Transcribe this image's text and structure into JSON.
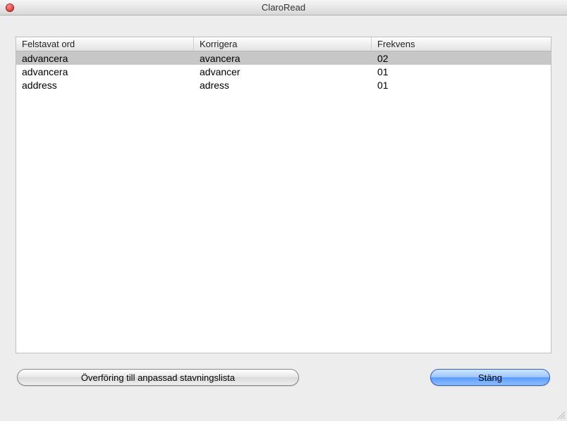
{
  "window": {
    "title": "ClaroRead"
  },
  "table": {
    "headers": {
      "misspelled": "Felstavat ord",
      "correction": "Korrigera",
      "frequency": "Frekvens"
    },
    "rows": [
      {
        "misspelled": "advancera",
        "correction": "avancera",
        "frequency": "02",
        "selected": true
      },
      {
        "misspelled": "advancera",
        "correction": "advancer",
        "frequency": "01",
        "selected": false
      },
      {
        "misspelled": "address",
        "correction": "adress",
        "frequency": "01",
        "selected": false
      }
    ]
  },
  "buttons": {
    "transfer": "Överföring till anpassad stavningslista",
    "close": "Stäng"
  }
}
